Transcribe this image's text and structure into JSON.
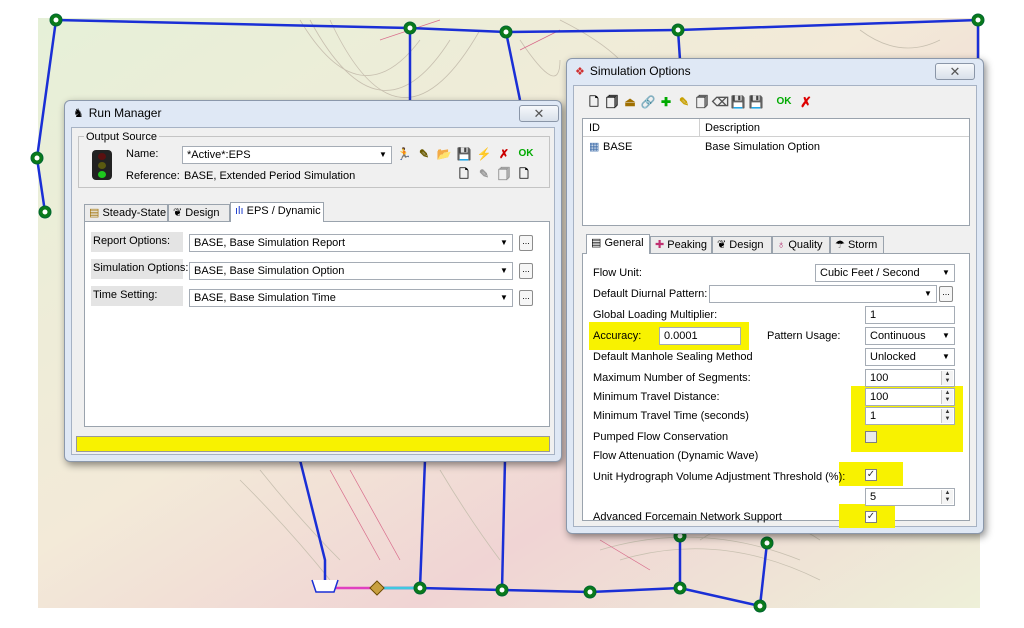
{
  "run_manager": {
    "title": "Run Manager",
    "close": "✕",
    "output_source": "Output Source",
    "name_label": "Name:",
    "name_value": "*Active*:EPS",
    "reference_label": "Reference:",
    "reference_value": "BASE, Extended Period Simulation",
    "ok_label": "OK",
    "tabs": [
      "Steady-State",
      "Design",
      "EPS / Dynamic"
    ],
    "rows": [
      {
        "label": "Report Options:",
        "value": "BASE, Base Simulation Report"
      },
      {
        "label": "Simulation Options:",
        "value": "BASE, Base Simulation Option"
      },
      {
        "label": "Time Setting:",
        "value": "BASE, Base Simulation Time"
      }
    ],
    "ellipsis": "..."
  },
  "simulation_options": {
    "title": "Simulation Options",
    "close": "✕",
    "ok_label": "OK",
    "list_headers": [
      "ID",
      "Description"
    ],
    "list_rows": [
      {
        "id": "BASE",
        "description": "Base Simulation Option"
      }
    ],
    "tabs": [
      "General",
      "Peaking",
      "Design",
      "Quality",
      "Storm"
    ],
    "flow_unit_label": "Flow Unit:",
    "flow_unit_value": "Cubic Feet / Second",
    "diurnal_label": "Default Diurnal Pattern:",
    "diurnal_value": "",
    "global_loading_label": "Global Loading Multiplier:",
    "global_loading_value": "1",
    "accuracy_label": "Accuracy:",
    "accuracy_value": "0.0001",
    "pattern_usage_label": "Pattern Usage:",
    "pattern_usage_value": "Continuous",
    "manhole_label": "Default Manhole Sealing Method",
    "manhole_value": "Unlocked",
    "max_segments_label": "Maximum Number of Segments:",
    "max_segments_value": "100",
    "min_travel_distance_label": "Minimum Travel Distance:",
    "min_travel_distance_value": "100",
    "min_travel_time_label": "Minimum Travel Time (seconds)",
    "min_travel_time_value": "1",
    "pumped_flow_label": "Pumped Flow Conservation",
    "flow_attenuation_label": "Flow Attenuation (Dynamic Wave)",
    "unit_hydro_label": "Unit Hydrograph Volume Adjustment Threshold (%):",
    "unit_hydro_value": "5",
    "forcemain_label": "Advanced Forcemain Network Support",
    "checks": {
      "pumped_flow": false,
      "flow_attenuation": true,
      "forcemain": true
    },
    "check_mark": "✓",
    "ellipsis": "..."
  },
  "colors": {
    "highlight": "#f8f200",
    "pipe": "#1a2fd6",
    "node": "#0a7a1a"
  }
}
